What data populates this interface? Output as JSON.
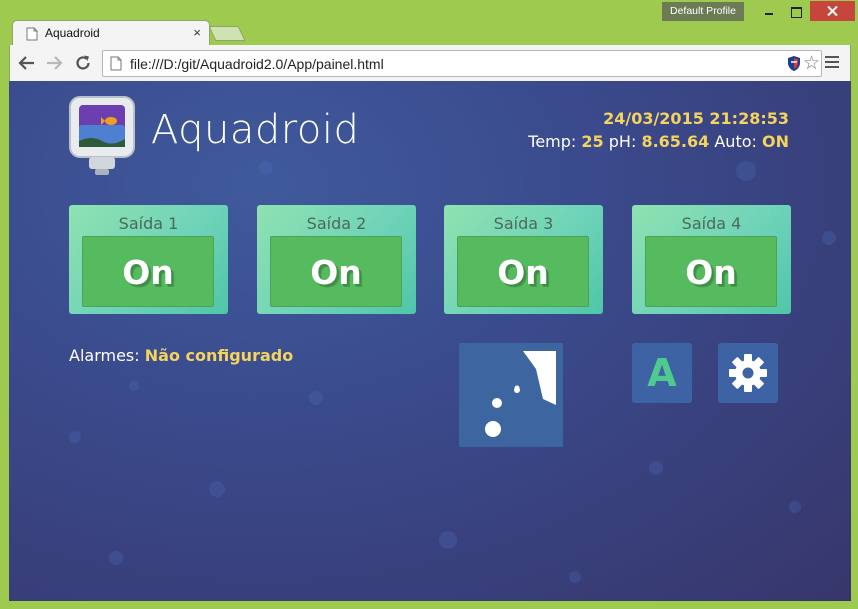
{
  "window": {
    "profile_label": "Default Profile"
  },
  "tab": {
    "title": "Aquadroid",
    "close_glyph": "×"
  },
  "toolbar": {
    "url": "file:///D:/git/Aquadroid2.0/App/painel.html"
  },
  "header": {
    "app_title": "Aquadroid",
    "datetime": "24/03/2015 21:28:53",
    "temp_label": "Temp:",
    "temp_value": "25",
    "ph_label": "pH:",
    "ph_value": "8.65.64",
    "auto_label": "Auto:",
    "auto_value": "ON"
  },
  "outlets": [
    {
      "label": "Saída 1",
      "state": "On"
    },
    {
      "label": "Saída 2",
      "state": "On"
    },
    {
      "label": "Saída 3",
      "state": "On"
    },
    {
      "label": "Saída 4",
      "state": "On"
    }
  ],
  "alarms": {
    "label": "Alarmes:",
    "value": "Não configurado"
  },
  "actions": {
    "auto_letter": "A"
  },
  "colors": {
    "chrome_accent": "#9dca4f",
    "page_bg": "#3a4a8c",
    "highlight_text": "#f4d35e",
    "outlet_button": "#56bb5e",
    "auto_letter": "#4fc98e"
  },
  "icons": [
    "doc-icon",
    "back-arrow-icon",
    "forward-arrow-icon",
    "reload-icon",
    "page-icon",
    "shield-icon",
    "star-icon",
    "menu-icon",
    "aquarium-logo-icon",
    "feeder-icon",
    "gear-icon"
  ]
}
